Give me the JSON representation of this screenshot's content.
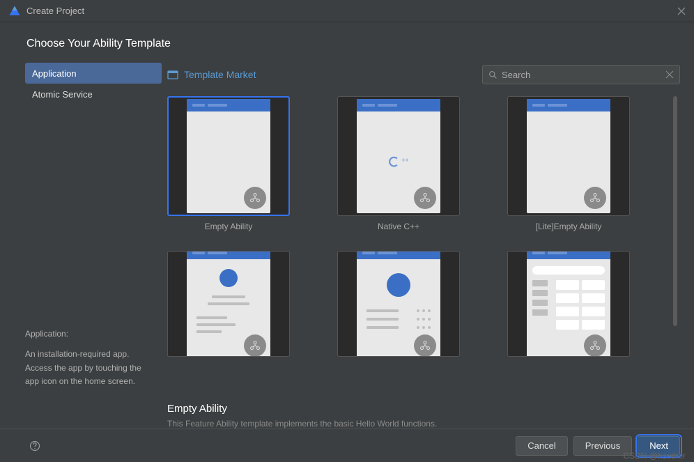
{
  "titlebar": {
    "title": "Create Project"
  },
  "heading": "Choose Your Ability Template",
  "sidebar": {
    "items": [
      {
        "label": "Application",
        "selected": true
      },
      {
        "label": "Atomic Service",
        "selected": false
      }
    ],
    "desc_title": "Application:",
    "desc_body": "An installation-required app. Access the app by touching the app icon on the home screen."
  },
  "toolbar": {
    "market_label": "Template Market",
    "search_placeholder": "Search"
  },
  "templates": [
    {
      "label": "Empty Ability",
      "kind": "empty",
      "selected": true
    },
    {
      "label": "Native C++",
      "kind": "native",
      "selected": false
    },
    {
      "label": "[Lite]Empty Ability",
      "kind": "empty",
      "selected": false
    },
    {
      "label": "",
      "kind": "profile",
      "selected": false
    },
    {
      "label": "",
      "kind": "list",
      "selected": false
    },
    {
      "label": "",
      "kind": "grid",
      "selected": false
    }
  ],
  "detail": {
    "title": "Empty Ability",
    "desc": "This Feature Ability template implements the basic Hello World functions."
  },
  "footer": {
    "cancel": "Cancel",
    "previous": "Previous",
    "next": "Next"
  },
  "watermark": "CSDN @hzether"
}
